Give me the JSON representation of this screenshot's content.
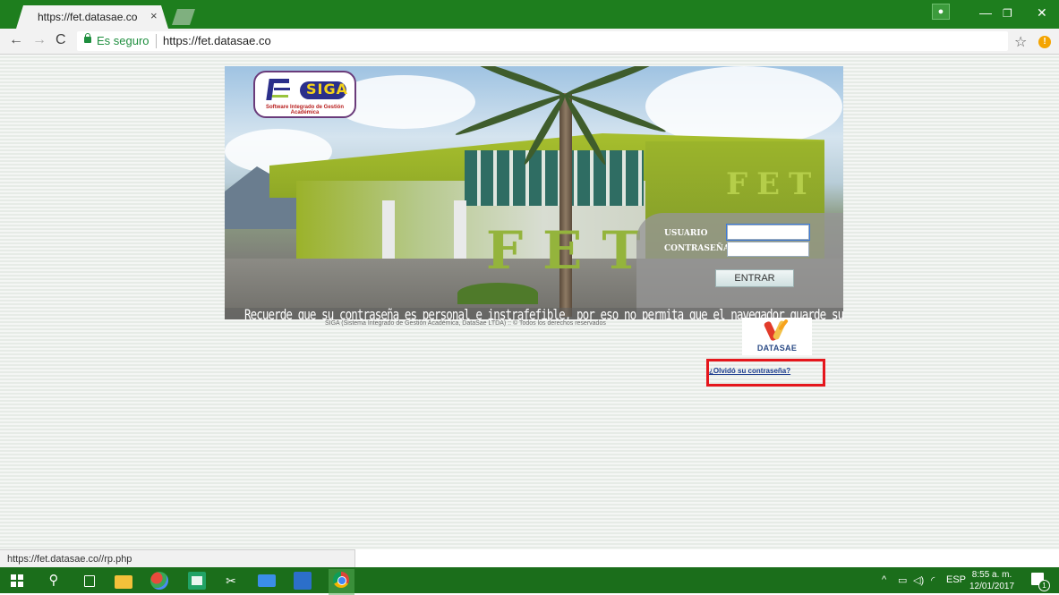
{
  "browser": {
    "tab_title": "https://fet.datasae.co",
    "tab_close": "×",
    "secure_label": "Es seguro",
    "url": "https://fet.datasae.co",
    "window_user_icon": "user-icon",
    "window_minimize": "—",
    "window_maximize": "❐",
    "window_close": "✕"
  },
  "banner": {
    "logo_text": "SIGA",
    "logo_subtitle": "Software Integrado de Gestión Académica",
    "building_letters": "FET",
    "building_letters_small": "FET",
    "notice": "Recuerde que su contraseña es personal e instrafefible, por eso no permita que el navegador guarde su clave"
  },
  "login": {
    "user_label": "USUARIO",
    "password_label": "CONTRASEÑA",
    "user_value": "",
    "password_value": "",
    "submit_label": "ENTRAR"
  },
  "footer": {
    "copyright": "SIGA (Sistema Integrado de Gestión Académica, DataSae LTDA) :: © Todos los derechos reservados",
    "brand": "DATASAE",
    "forgot_link": "¿Olvidó su contraseña?"
  },
  "status_bar": {
    "hover_url": "https://fet.datasae.co//rp.php"
  },
  "taskbar": {
    "tray_language": "ESP",
    "clock_time": "8:55 a. m.",
    "clock_date": "12/01/2017",
    "notification_count": "1"
  },
  "colors": {
    "chrome_frame": "#1e7e1e",
    "taskbar": "#1b6e1b",
    "secure_green": "#1e8e3e",
    "highlight_red": "#e5161c",
    "link_blue": "#1a3b8f"
  }
}
